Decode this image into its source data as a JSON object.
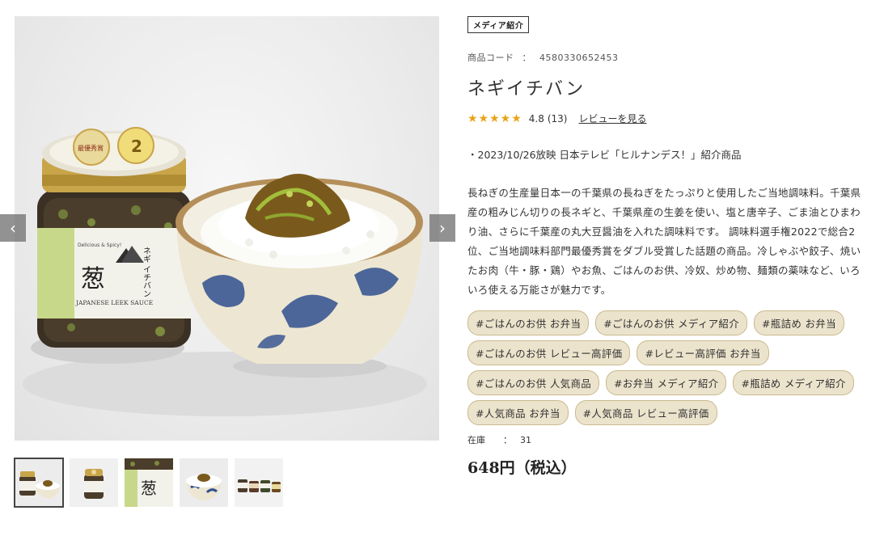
{
  "gallery": {
    "prev_arrow": "‹",
    "next_arrow": "›",
    "jar_label_main": "葱",
    "jar_label_side": "ネギ イチバン",
    "jar_label_en": "JAPANESE LEEK SAUCE",
    "jar_label_tag": "Delicious & Spicy!",
    "award_text": "最優秀賞",
    "award_rank": "2",
    "thumbnails": [
      "thumb-bowl-jar",
      "thumb-jar",
      "thumb-jar-closeup",
      "thumb-bowl",
      "thumb-lineup"
    ]
  },
  "product": {
    "badge": "メディア紹介",
    "code_label": "商品コード",
    "code_sep": "：",
    "code_value": "4580330652453",
    "title": "ネギイチバン",
    "stars": "★★★★★",
    "rating": "4.8",
    "rating_count": "(13)",
    "review_link": "レビューを見る",
    "news": "・2023/10/26放映 日本テレビ「ヒルナンデス！」紹介商品",
    "description": "長ねぎの生産量日本一の千葉県の長ねぎをたっぷりと使用したご当地調味料。千葉県産の粗みじん切りの長ネギと、千葉県産の生姜を使い、塩と唐辛子、ごま油とひまわり油、さらに千葉産の丸大豆醤油を入れた調味料です。 調味料選手権2022で総合2位、ご当地調味料部門最優秀賞をダブル受賞した話題の商品。冷しゃぶや餃子、焼いたお肉（牛・豚・鶏）やお魚、ごはんのお供、冷奴、炒め物、麺類の薬味など、いろいろ使える万能さが魅力です。",
    "tags": [
      "#ごはんのお供 お弁当",
      "#ごはんのお供 メディア紹介",
      "#瓶詰め お弁当",
      "#ごはんのお供 レビュー高評価",
      "#レビュー高評価 お弁当",
      "#ごはんのお供 人気商品",
      "#お弁当 メディア紹介",
      "#瓶詰め メディア紹介",
      "#人気商品 お弁当",
      "#人気商品 レビュー高評価"
    ],
    "stock_label": "在庫",
    "stock_sep": "：",
    "stock_value": "31",
    "price": "648円（税込）"
  },
  "colors": {
    "star": "#e8a317",
    "tag_bg": "#ece3cc",
    "tag_border": "#c9b98e",
    "bowl_blue": "#2f4f8f"
  }
}
